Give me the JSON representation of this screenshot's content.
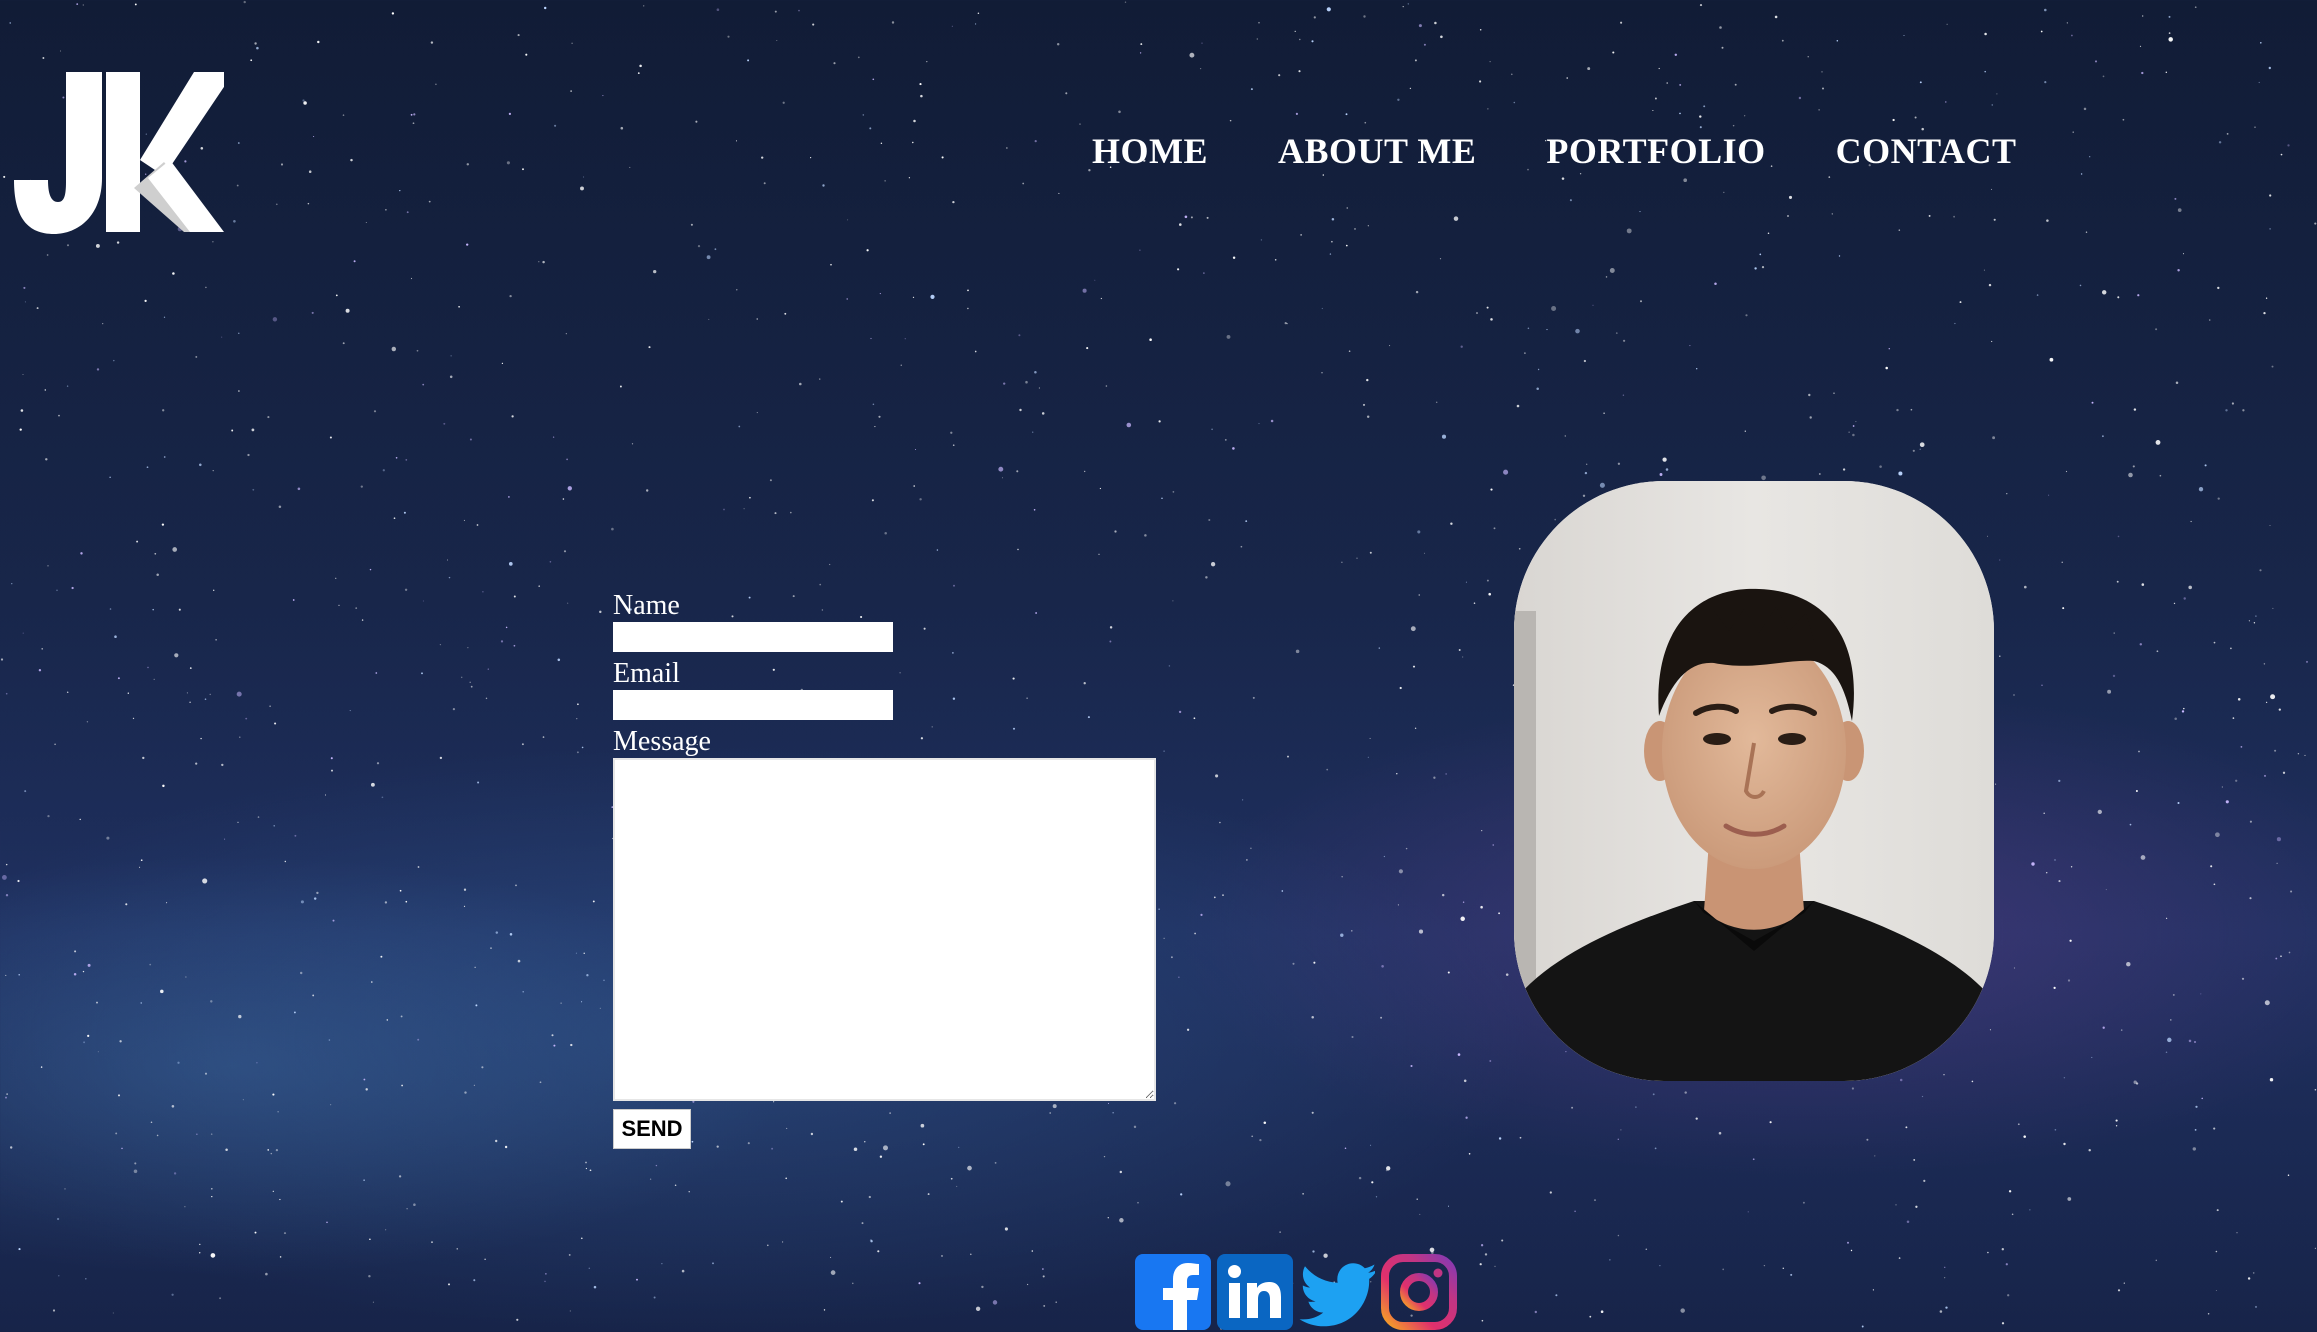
{
  "logo": {
    "text": "JK",
    "icon": "jk-logo-icon"
  },
  "nav": {
    "items": [
      {
        "label": "HOME"
      },
      {
        "label": "ABOUT ME"
      },
      {
        "label": "PORTFOLIO"
      },
      {
        "label": "CONTACT"
      }
    ]
  },
  "form": {
    "name_label": "Name",
    "name_value": "",
    "email_label": "Email",
    "email_value": "",
    "message_label": "Message",
    "message_value": "",
    "send_label": "SEND"
  },
  "portrait": {
    "icon": "profile-photo"
  },
  "social": [
    {
      "name": "facebook",
      "icon": "facebook-icon",
      "color": "#1877f2"
    },
    {
      "name": "linkedin",
      "icon": "linkedin-icon",
      "color": "#0a66c2"
    },
    {
      "name": "twitter",
      "icon": "twitter-icon",
      "color": "#1da1f2"
    },
    {
      "name": "instagram",
      "icon": "instagram-icon",
      "color": "#c13584"
    }
  ],
  "colors": {
    "nav_text": "#ffffff",
    "background": "#18264a"
  }
}
